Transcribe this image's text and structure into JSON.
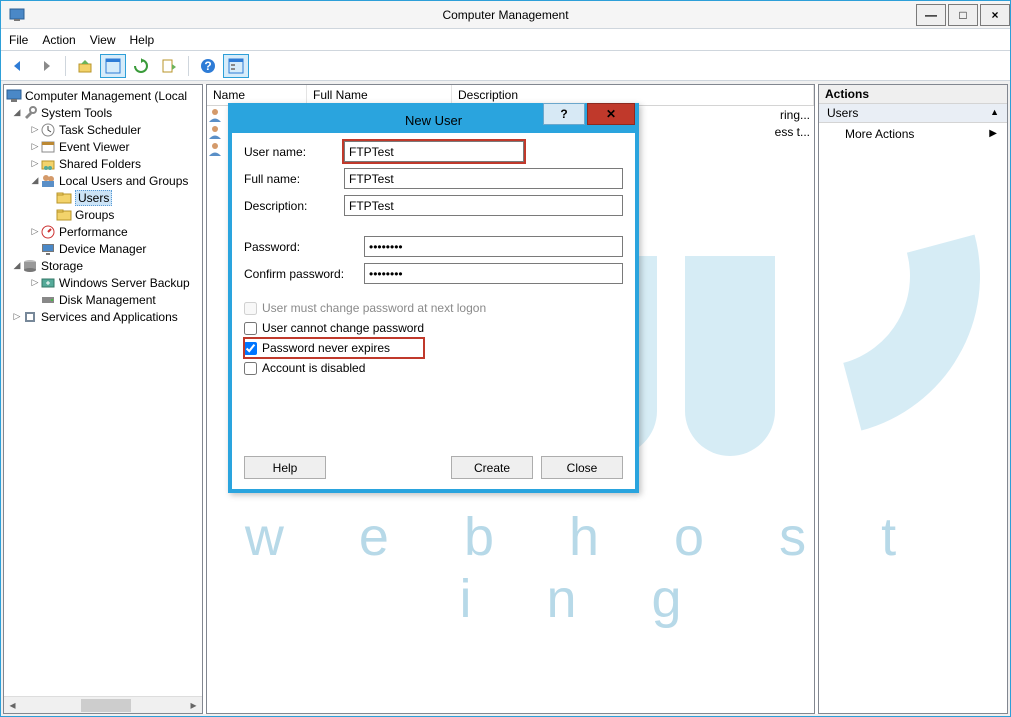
{
  "window": {
    "title": "Computer Management",
    "min": "—",
    "max": "□",
    "close": "×"
  },
  "menu": {
    "file": "File",
    "action": "Action",
    "view": "View",
    "help": "Help"
  },
  "tree": {
    "root": "Computer Management (Local",
    "system_tools": "System Tools",
    "task_sched": "Task Scheduler",
    "event_viewer": "Event Viewer",
    "shared_folders": "Shared Folders",
    "local_users": "Local Users and Groups",
    "users": "Users",
    "groups": "Groups",
    "performance": "Performance",
    "device_mgr": "Device Manager",
    "storage": "Storage",
    "wsbackup": "Windows Server Backup",
    "disk_mgmt": "Disk Management",
    "services_apps": "Services and Applications"
  },
  "list": {
    "col_name": "Name",
    "col_fullname": "Full Name",
    "col_desc": "Description",
    "rows": [
      {
        "name": "",
        "full": "",
        "desc": "ring..."
      },
      {
        "name": "",
        "full": "",
        "desc": "ess t..."
      },
      {
        "name": "",
        "full": "",
        "desc": ""
      }
    ]
  },
  "actions": {
    "header": "Actions",
    "section": "Users",
    "more": "More Actions"
  },
  "dialog": {
    "title": "New User",
    "help_btn": "?",
    "close_btn": "✕",
    "labels": {
      "username": "User name:",
      "fullname": "Full name:",
      "description": "Description:",
      "password": "Password:",
      "confirm": "Confirm password:"
    },
    "values": {
      "username": "FTPTest",
      "fullname": "FTPTest",
      "description": "FTPTest",
      "password": "••••••••",
      "confirm": "••••••••"
    },
    "checks": {
      "mustchange": "User must change password at next logon",
      "cannot": "User cannot change password",
      "never": "Password never expires",
      "disabled": "Account is disabled"
    },
    "buttons": {
      "help": "Help",
      "create": "Create",
      "close": "Close"
    }
  },
  "watermark": {
    "line": "w e b     h o s t i n g"
  }
}
